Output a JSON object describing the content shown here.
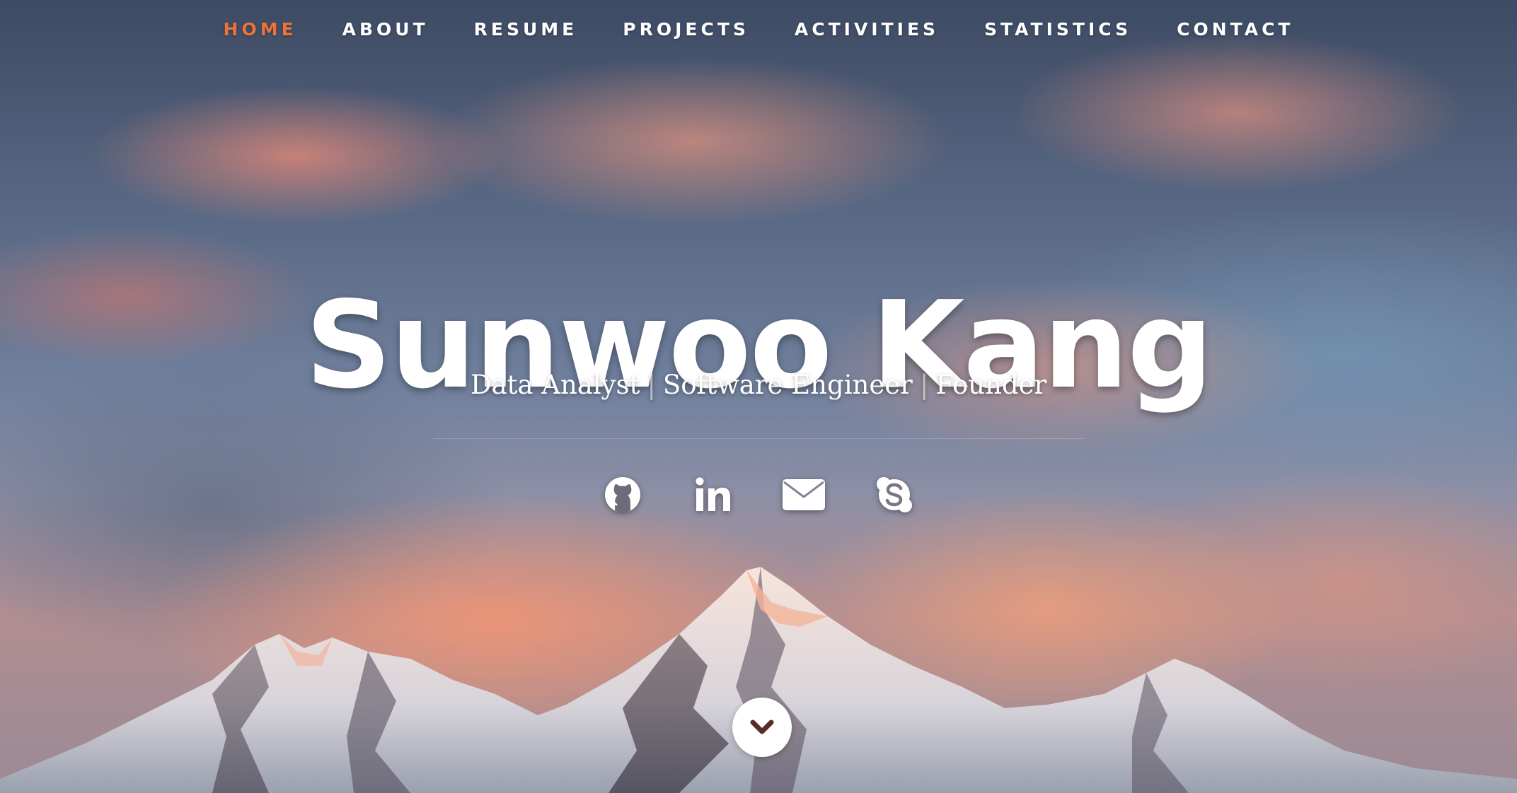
{
  "nav": {
    "items": [
      {
        "label": "HOME",
        "active": true
      },
      {
        "label": "ABOUT",
        "active": false
      },
      {
        "label": "RESUME",
        "active": false
      },
      {
        "label": "PROJECTS",
        "active": false
      },
      {
        "label": "ACTIVITIES",
        "active": false
      },
      {
        "label": "STATISTICS",
        "active": false
      },
      {
        "label": "CONTACT",
        "active": false
      }
    ]
  },
  "hero": {
    "title": "Sunwoo Kang",
    "subtitle_parts": [
      "Data Analyst",
      "Software Engineer",
      "Founder"
    ],
    "subtitle_separator": "|",
    "background": "sunset-mountain-photo"
  },
  "social": {
    "links": [
      {
        "icon": "github-icon"
      },
      {
        "icon": "linkedin-icon"
      },
      {
        "icon": "envelope-icon"
      },
      {
        "icon": "skype-icon"
      }
    ]
  },
  "scroll_down": {
    "icon": "chevron-down-icon"
  },
  "colors": {
    "accent": "#e9733a",
    "text": "#ffffff",
    "chevron": "#5a2b2b"
  }
}
